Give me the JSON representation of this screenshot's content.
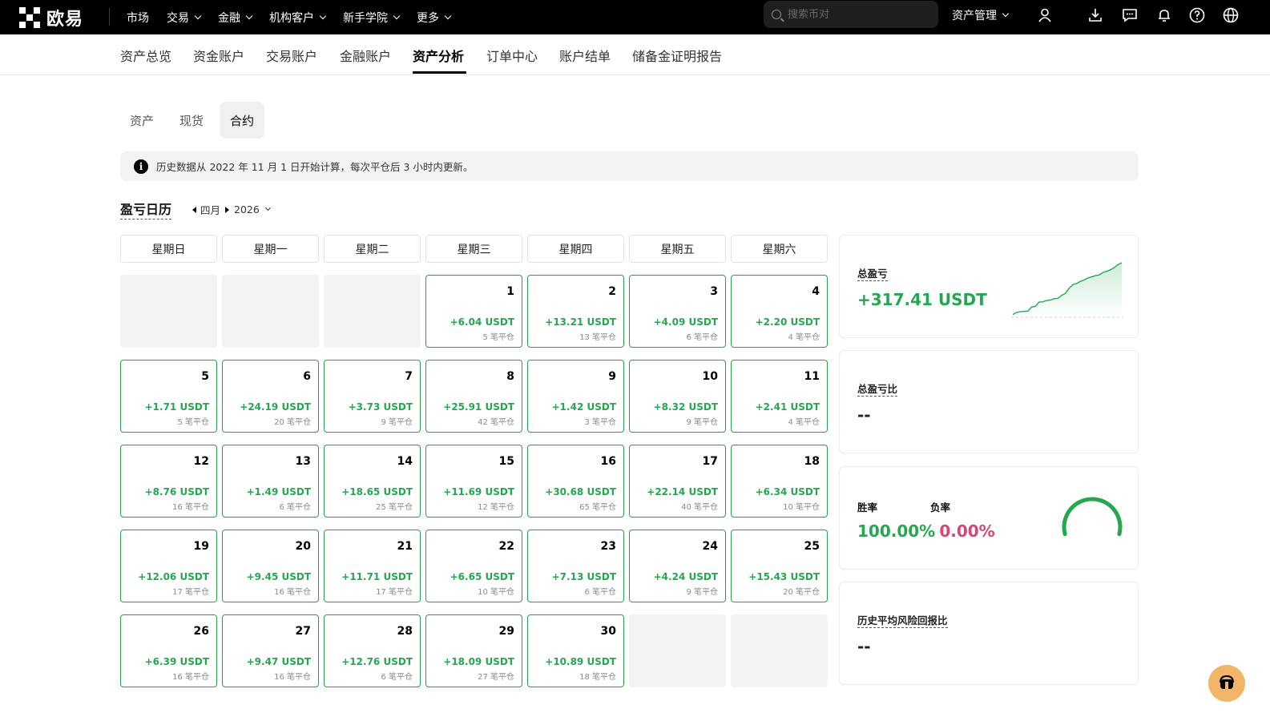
{
  "header": {
    "logo_text": "欧易",
    "nav": [
      "市场",
      "交易",
      "金融",
      "机构客户",
      "新手学院",
      "更多"
    ],
    "search_placeholder": "搜索币对",
    "asset_mgmt": "资产管理"
  },
  "subnav": {
    "tabs": [
      "资产总览",
      "资金账户",
      "交易账户",
      "金融账户",
      "资产分析",
      "订单中心",
      "账户结单",
      "储备金证明报告"
    ],
    "active": "资产分析"
  },
  "content_tabs": {
    "tabs": [
      "资产",
      "现货",
      "合约"
    ],
    "active": "合约"
  },
  "notice": "历史数据从 2022 年 11 月 1 日开始计算，每次平仓后 3 小时内更新。",
  "calendar": {
    "title": "盈亏日历",
    "month": "四月",
    "year": "2026",
    "weekdays": [
      "星期日",
      "星期一",
      "星期二",
      "星期三",
      "星期四",
      "星期五",
      "星期六"
    ],
    "days": [
      {
        "day": "1",
        "pnl": "+6.04 USDT",
        "count": "5 笔平仓"
      },
      {
        "day": "2",
        "pnl": "+13.21 USDT",
        "count": "13 笔平仓"
      },
      {
        "day": "3",
        "pnl": "+4.09 USDT",
        "count": "6 笔平仓"
      },
      {
        "day": "4",
        "pnl": "+2.20 USDT",
        "count": "4 笔平仓"
      },
      {
        "day": "5",
        "pnl": "+1.71 USDT",
        "count": "5 笔平仓"
      },
      {
        "day": "6",
        "pnl": "+24.19 USDT",
        "count": "20 笔平仓"
      },
      {
        "day": "7",
        "pnl": "+3.73 USDT",
        "count": "9 笔平仓"
      },
      {
        "day": "8",
        "pnl": "+25.91 USDT",
        "count": "42 笔平仓"
      },
      {
        "day": "9",
        "pnl": "+1.42 USDT",
        "count": "3 笔平仓"
      },
      {
        "day": "10",
        "pnl": "+8.32 USDT",
        "count": "9 笔平仓"
      },
      {
        "day": "11",
        "pnl": "+2.41 USDT",
        "count": "4 笔平仓"
      },
      {
        "day": "12",
        "pnl": "+8.76 USDT",
        "count": "16 笔平仓"
      },
      {
        "day": "13",
        "pnl": "+1.49 USDT",
        "count": "6 笔平仓"
      },
      {
        "day": "14",
        "pnl": "+18.65 USDT",
        "count": "25 笔平仓"
      },
      {
        "day": "15",
        "pnl": "+11.69 USDT",
        "count": "12 笔平仓"
      },
      {
        "day": "16",
        "pnl": "+30.68 USDT",
        "count": "65 笔平仓"
      },
      {
        "day": "17",
        "pnl": "+22.14 USDT",
        "count": "40 笔平仓"
      },
      {
        "day": "18",
        "pnl": "+6.34 USDT",
        "count": "10 笔平仓"
      },
      {
        "day": "19",
        "pnl": "+12.06 USDT",
        "count": "17 笔平仓"
      },
      {
        "day": "20",
        "pnl": "+9.45 USDT",
        "count": "16 笔平仓"
      },
      {
        "day": "21",
        "pnl": "+11.71 USDT",
        "count": "17 笔平仓"
      },
      {
        "day": "22",
        "pnl": "+6.65 USDT",
        "count": "10 笔平仓"
      },
      {
        "day": "23",
        "pnl": "+7.13 USDT",
        "count": "6 笔平仓"
      },
      {
        "day": "24",
        "pnl": "+4.24 USDT",
        "count": "9 笔平仓"
      },
      {
        "day": "25",
        "pnl": "+15.43 USDT",
        "count": "20 笔平仓"
      },
      {
        "day": "26",
        "pnl": "+6.39 USDT",
        "count": "16 笔平仓"
      },
      {
        "day": "27",
        "pnl": "+9.47 USDT",
        "count": "16 笔平仓"
      },
      {
        "day": "28",
        "pnl": "+12.76 USDT",
        "count": "6 笔平仓"
      },
      {
        "day": "29",
        "pnl": "+18.09 USDT",
        "count": "27 笔平仓"
      },
      {
        "day": "30",
        "pnl": "+10.89 USDT",
        "count": "18 笔平仓"
      }
    ]
  },
  "stats": {
    "total_pnl_label": "总盈亏",
    "total_pnl_value": "+317.41 USDT",
    "total_pnl_ratio_label": "总盈亏比",
    "total_pnl_ratio_value": "--",
    "win_rate_label": "胜率",
    "loss_rate_label": "负率",
    "win_rate_value": "100.00%",
    "loss_rate_value": "0.00%",
    "win_rate_fraction": 1.0,
    "risk_return_label": "历史平均风险回报比",
    "risk_return_value": "--"
  },
  "colors": {
    "profit": "#25a750",
    "loss": "#d9466f"
  },
  "icons": [
    "search-icon",
    "user-icon",
    "download-icon",
    "message-icon",
    "bell-icon",
    "help-icon",
    "globe-icon",
    "info-icon",
    "headset-icon"
  ]
}
